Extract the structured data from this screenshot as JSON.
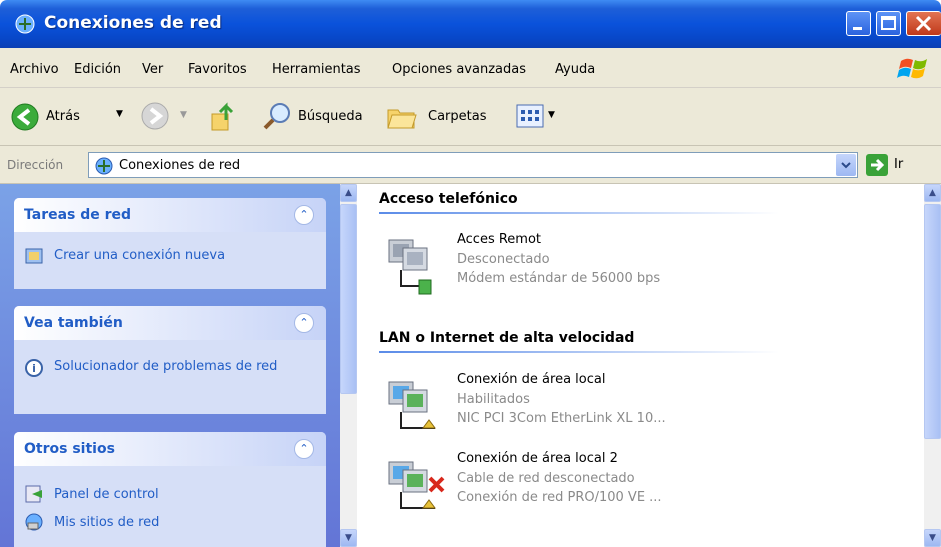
{
  "window": {
    "title": "Conexiones de red"
  },
  "menu": {
    "items": [
      "Archivo",
      "Edición",
      "Ver",
      "Favoritos",
      "Herramientas",
      "Opciones avanzadas",
      "Ayuda"
    ]
  },
  "toolbar": {
    "back_label": "Atrás",
    "search_label": "Búsqueda",
    "folders_label": "Carpetas"
  },
  "address": {
    "label": "Dirección",
    "value": "Conexiones de red",
    "go_label": "Ir"
  },
  "taskpane": {
    "panels": [
      {
        "title": "Tareas de red",
        "items": [
          "Crear una conexión nueva"
        ]
      },
      {
        "title": "Vea también",
        "items": [
          "Solucionador de problemas de red"
        ]
      },
      {
        "title": "Otros sitios",
        "items": [
          "Panel de control",
          "Mis sitios de red"
        ]
      }
    ]
  },
  "content": {
    "groups": [
      {
        "header": "Acceso telefónico",
        "connections": [
          {
            "name": "Acces Remot",
            "status": "Desconectado",
            "device": "Módem estándar de 56000 bps"
          }
        ]
      },
      {
        "header": "LAN o Internet de alta velocidad",
        "connections": [
          {
            "name": "Conexión de área local",
            "status": "Habilitados",
            "device": "NIC PCI 3Com EtherLink XL 10..."
          },
          {
            "name": "Conexión de área local 2",
            "status": "Cable de red desconectado",
            "device": "Conexión de red PRO/100 VE ..."
          }
        ]
      }
    ]
  },
  "colors": {
    "titlebar": "#0a52db",
    "menubar": "#ece9d8",
    "taskpane": "#6375d6",
    "link": "#215dc6"
  }
}
